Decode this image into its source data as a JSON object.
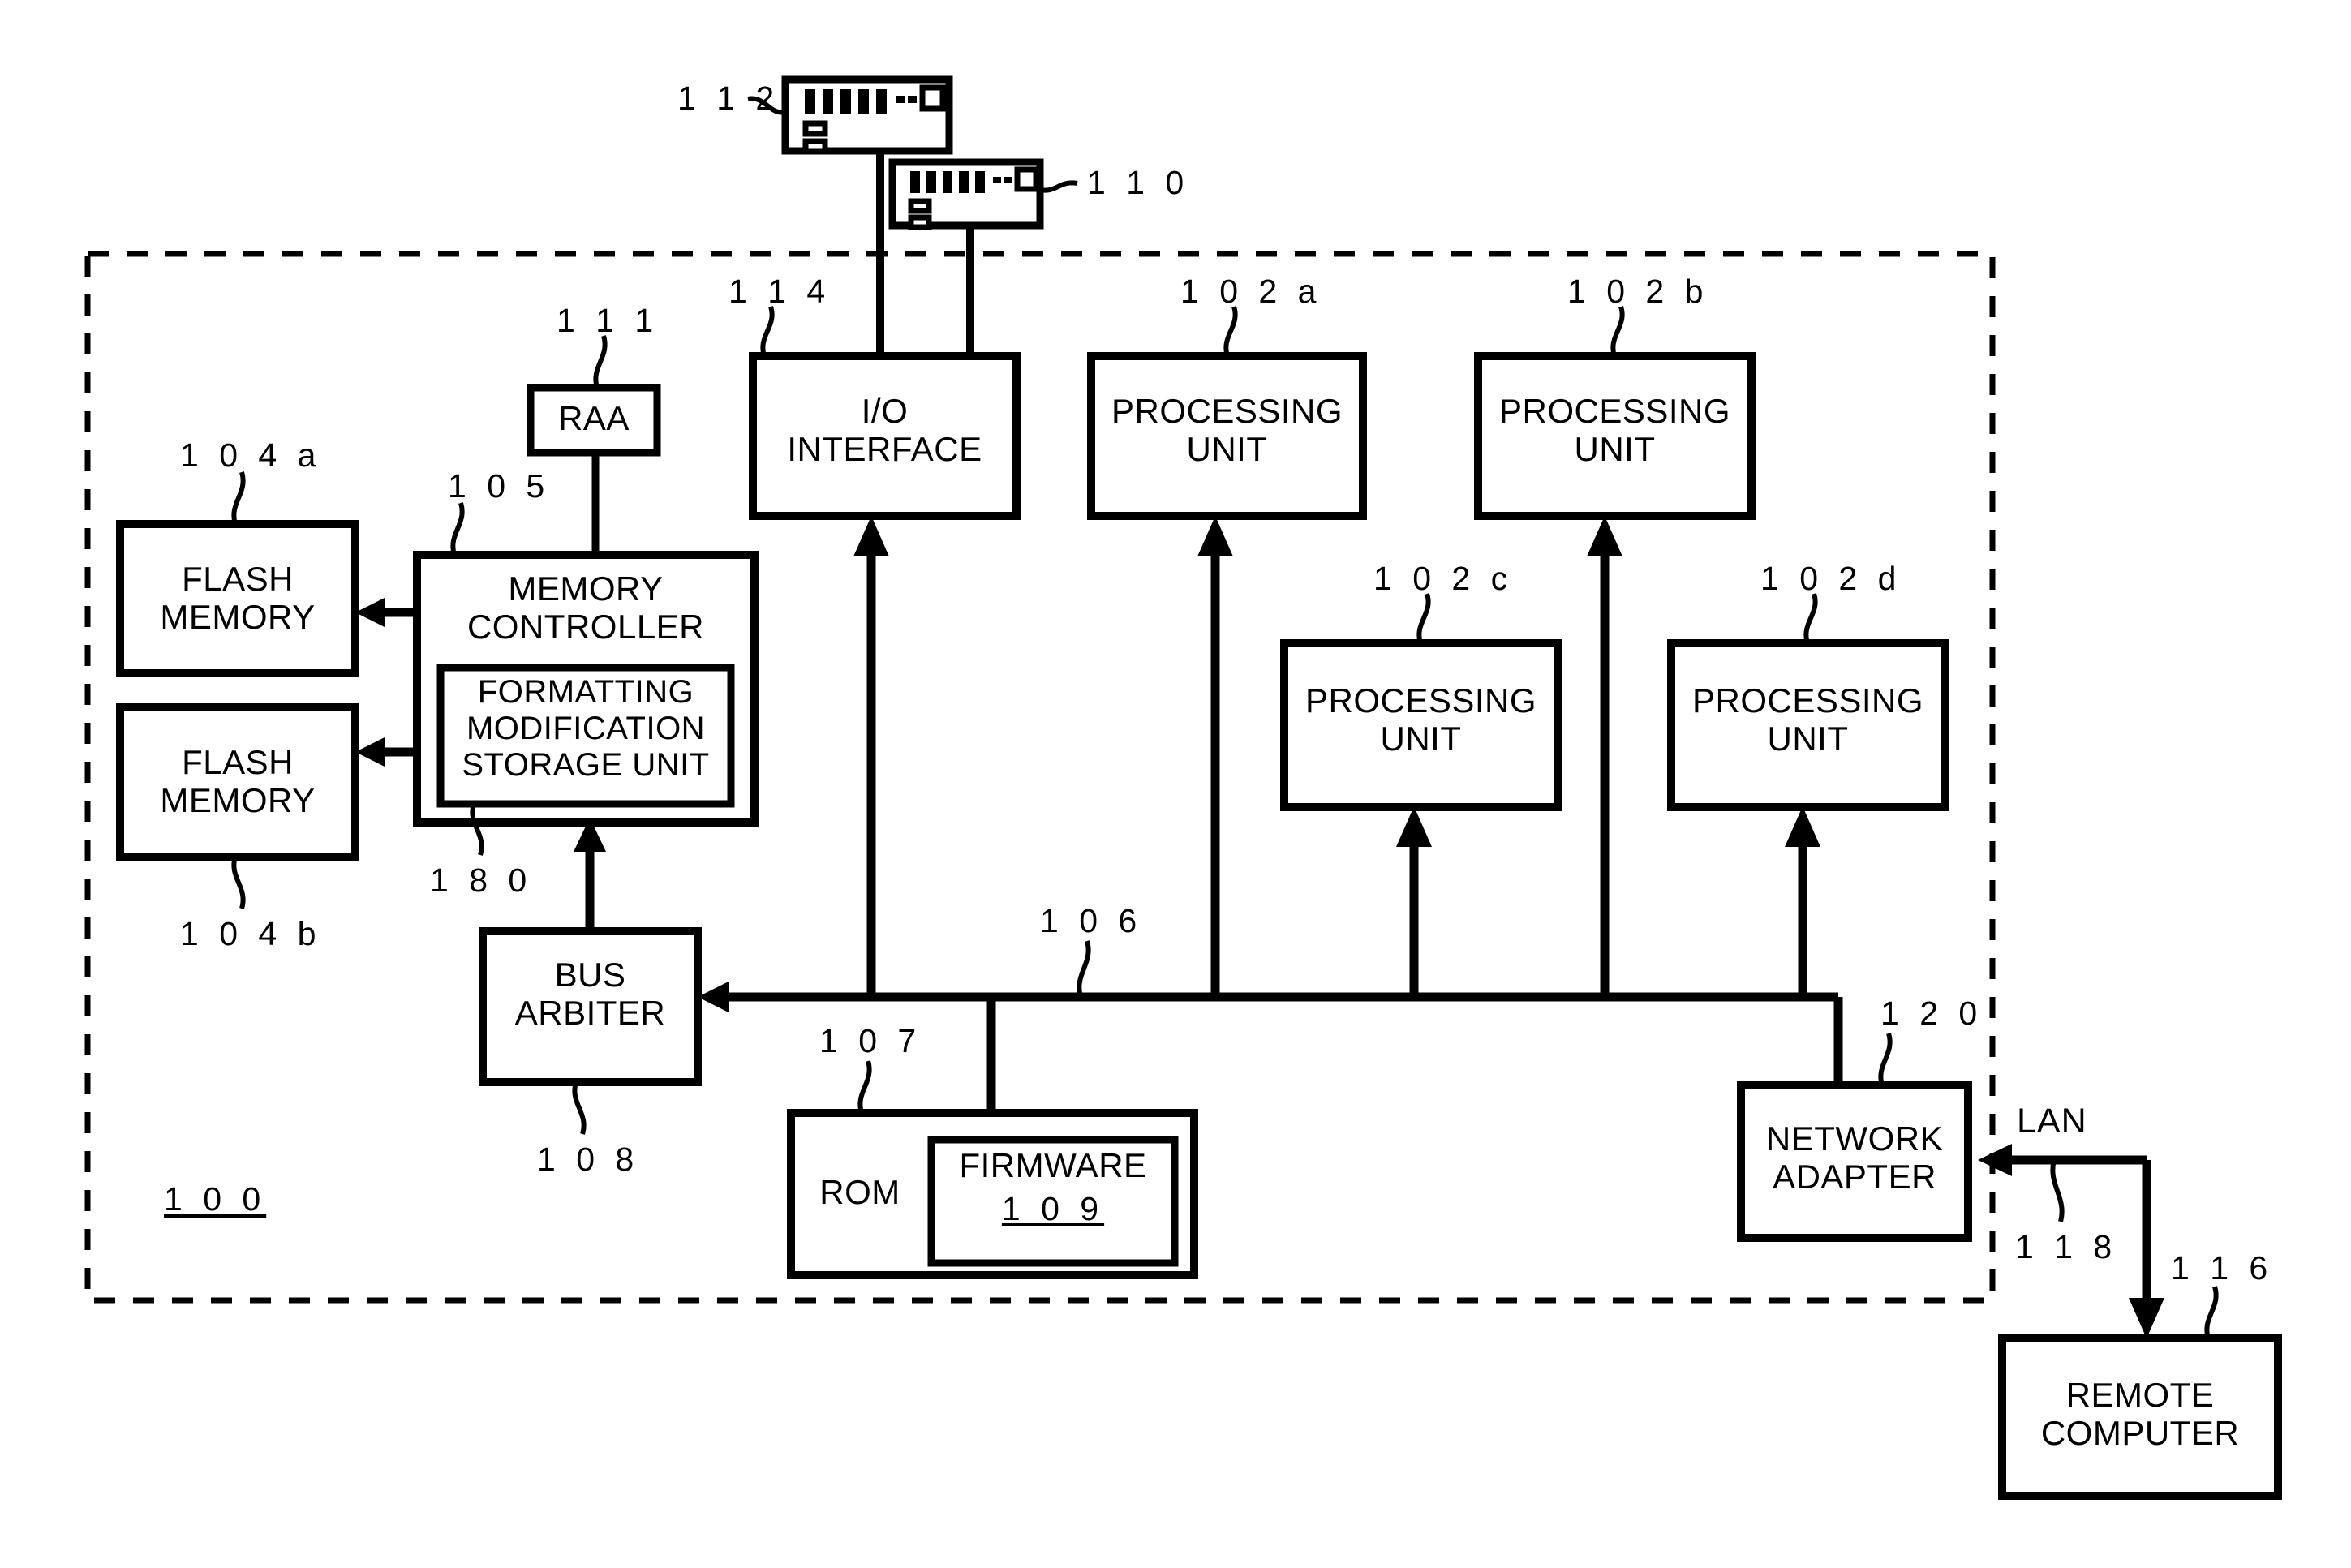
{
  "figure": {
    "kind": "patent-block-diagram",
    "system_ref": "1 0 0",
    "line_color": "#000000",
    "background": "#ffffff"
  },
  "blocks": {
    "flash_memory_a": {
      "label": "FLASH\nMEMORY",
      "ref": "1 0 4 a"
    },
    "flash_memory_b": {
      "label": "FLASH\nMEMORY",
      "ref": "1 0 4 b"
    },
    "memory_controller": {
      "label": "MEMORY\nCONTROLLER",
      "ref": "1 0 5"
    },
    "formatting_storage": {
      "label": "FORMATTING\nMODIFICATION\nSTORAGE UNIT",
      "ref": "1 8 0"
    },
    "raa": {
      "label": "RAA",
      "ref": "1 1 1"
    },
    "bus_arbiter": {
      "label": "BUS\nARBITER",
      "ref": "1 0 8"
    },
    "io_interface": {
      "label": "I/O\nINTERFACE",
      "ref": "1 1 4"
    },
    "processing_unit_a": {
      "label": "PROCESSING\nUNIT",
      "ref": "1 0 2 a"
    },
    "processing_unit_b": {
      "label": "PROCESSING\nUNIT",
      "ref": "1 0 2 b"
    },
    "processing_unit_c": {
      "label": "PROCESSING\nUNIT",
      "ref": "1 0 2 c"
    },
    "processing_unit_d": {
      "label": "PROCESSING\nUNIT",
      "ref": "1 0 2 d"
    },
    "rom": {
      "label": "ROM",
      "ref": "1 0 7"
    },
    "firmware": {
      "label": "FIRMWARE",
      "ref": "1 0 9"
    },
    "network_adapter": {
      "label": "NETWORK\nADAPTER",
      "ref": "1 2 0"
    },
    "remote_computer": {
      "label": "REMOTE\nCOMPUTER",
      "ref": "1 1 6"
    },
    "device_upper": {
      "ref": "1 1 2"
    },
    "device_lower": {
      "ref": "1 1 0"
    }
  },
  "connections": {
    "bus": {
      "ref": "1 0 6"
    },
    "lan": {
      "label": "LAN",
      "ref": "1 1 8"
    }
  }
}
